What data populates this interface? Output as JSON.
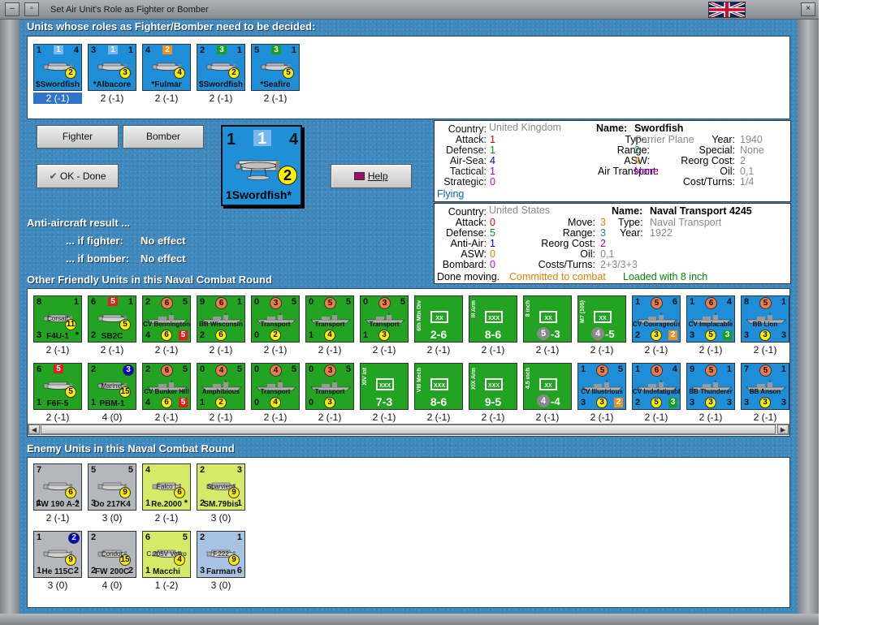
{
  "window": {
    "title": "Set Air Unit's Role as Fighter or Bomber"
  },
  "colors": {
    "panel_blue": "#3f88be",
    "naval": "#1e8ed8",
    "land": "#22a322",
    "enemy_grey": "#b4b8bc",
    "italian": "#d6ea6a",
    "french": "#a7c2e2"
  },
  "sections": {
    "decide": "Units whose roles as Fighter/Bomber need to be decided:",
    "friendly": "Other Friendly Units in this Naval Combat Round",
    "enemy": "Enemy Units in this Naval Combat Round"
  },
  "undecided": [
    {
      "name": "Swordfish",
      "prefix": "$",
      "tl": "1",
      "tr": "4",
      "top": "1",
      "top_color": "#79b7f0",
      "circle": "2",
      "sub": "2 (-1)",
      "selected": true
    },
    {
      "name": "Albacore",
      "prefix": "*",
      "tl": "3",
      "tr": "1",
      "top": "1",
      "top_color": "#79b7f0",
      "circle": "3",
      "sub": "2 (-1)",
      "selected": false
    },
    {
      "name": "Fulmar",
      "prefix": "*",
      "tl": "4",
      "tr": "",
      "top": "2",
      "top_color": "#f09020",
      "circle": "4",
      "sub": "2 (-1)",
      "selected": false
    },
    {
      "name": "Swordfish",
      "prefix": "$",
      "tl": "2",
      "tr": "1",
      "top": "3",
      "top_color": "#1aa01a",
      "circle": "2",
      "sub": "2 (-1)",
      "selected": false
    },
    {
      "name": "Seafire",
      "prefix": "*",
      "tl": "5",
      "tr": "1",
      "top": "3",
      "top_color": "#1aa01a",
      "circle": "5",
      "sub": "2 (-1)",
      "selected": false
    }
  ],
  "buttons": {
    "fighter": "Fighter",
    "bomber": "Bomber",
    "ok": "OK - Done",
    "help": "Help"
  },
  "big_counter": {
    "tl": "1",
    "top": "1",
    "tr": "4",
    "circle": "2",
    "name": "1Swordfish*"
  },
  "anti_aircraft": {
    "header": "Anti-aircraft result ...",
    "fighter_label": "... if fighter:",
    "fighter_value": "No effect",
    "bomber_label": "... if bomber:",
    "bomber_value": "No effect"
  },
  "swordfish_info": {
    "country_label": "Country:",
    "country": "United Kingdom",
    "attack_label": "Attack:",
    "attack": "1",
    "defense_label": "Defense:",
    "defense": "1",
    "airsea_label": "Air-Sea:",
    "airsea": "4",
    "tactical_label": "Tactical:",
    "tactical": "1",
    "strategic_label": "Strategic:",
    "strategic": "0",
    "status": "Flying",
    "name_label": "Name:",
    "name": "Swordfish",
    "type_label": "Type:",
    "type": "Carrier Plane",
    "year_label": "Year:",
    "year": "1940",
    "range_label": "Range:",
    "range": "2",
    "special_label": "Special:",
    "special": "None",
    "asw_label": "ASW:",
    "asw": "4",
    "reorg_label": "Reorg Cost:",
    "reorg": "2",
    "airtransport_label": "Air Transport:",
    "airtransport": "None",
    "oil_label": "Oil:",
    "oil": "0,1",
    "costturns_label": "Cost/Turns:",
    "costturns": "1/4"
  },
  "transport_info": {
    "country_label": "Country:",
    "country": "United States",
    "attack_label": "Attack:",
    "attack": "0",
    "defense_label": "Defense:",
    "defense": "5",
    "antiair_label": "Anti-Air:",
    "antiair": "1",
    "asw_label": "ASW:",
    "asw": "0",
    "bombard_label": "Bombard:",
    "bombard": "0",
    "move_label": "Move:",
    "move": "3",
    "range_label": "Range:",
    "range": "3",
    "reorg_label": "Reorg Cost:",
    "reorg": "2",
    "oil_label": "Oil:",
    "oil": "0,1",
    "costturns_label": "Costs/Turns:",
    "costturns": "2+3/3+3",
    "name_label": "Name:",
    "name": "Naval Transport 4245",
    "type_label": "Type:",
    "type": "Naval Transport",
    "year_label": "Year:",
    "year": "1922",
    "status_done": "Done moving.",
    "status_committed": "Committed to combat",
    "status_loaded": "Loaded with 8 inch"
  },
  "friendly_row1": [
    {
      "kind": "air",
      "bg": "#22a322",
      "label": "F4U-1",
      "sub_label": "Corsair",
      "tl": "8",
      "tr": "1",
      "bl": "3",
      "circle": "11",
      "extra": "*",
      "caption": "2 (-1)"
    },
    {
      "kind": "air",
      "bg": "#22a322",
      "label": "SB2C",
      "tl": "6",
      "top": "5",
      "top_color": "#e02020",
      "tr": "1",
      "bl": "2",
      "circle": "5",
      "caption": "2 (-1)"
    },
    {
      "kind": "ship",
      "bg": "#22a322",
      "label": "CV Bennington",
      "tl": "2",
      "top": "6",
      "tr": "5",
      "bl": "4",
      "circle": "6",
      "br": "5",
      "br_color": "#e02020",
      "caption": "2 (-1)"
    },
    {
      "kind": "ship",
      "bg": "#22a322",
      "label": "BB Wisconsin",
      "tl": "9",
      "top": "6",
      "tr": "1",
      "bl": "2",
      "circle": "6",
      "caption": "2 (-1)"
    },
    {
      "kind": "ship",
      "bg": "#22a322",
      "label": "Transport",
      "tl": "0",
      "top": "3",
      "tr": "5",
      "bl": "0",
      "circle": "2",
      "caption": "2 (-1)"
    },
    {
      "kind": "ship",
      "bg": "#22a322",
      "label": "Transport",
      "tl": "0",
      "top": "5",
      "tr": "5",
      "bl": "1",
      "circle": "4",
      "caption": "2 (-1)"
    },
    {
      "kind": "ship",
      "bg": "#22a322",
      "label": "Transport",
      "tl": "0",
      "top": "3",
      "tr": "5",
      "bl": "1",
      "circle": "3",
      "caption": "2 (-1)"
    },
    {
      "kind": "land",
      "bg": "#22a322",
      "vert": "6th Mtn Div",
      "sym": "XX",
      "val": "2-6",
      "caption": "2 (-1)"
    },
    {
      "kind": "land",
      "bg": "#22a322",
      "vert": "III Arm",
      "sym": "XXX",
      "val": "8-6",
      "caption": "2 (-1)"
    },
    {
      "kind": "land",
      "bg": "#22a322",
      "vert": "8 inch",
      "sym": "XX",
      "val": "5-3",
      "grey": "5",
      "caption": "2 (-1)"
    },
    {
      "kind": "land",
      "bg": "#22a322",
      "vert": "M7 (105)",
      "sym": "XX",
      "val": "4-5",
      "grey": "4",
      "caption": "2 (-1)"
    },
    {
      "kind": "ship",
      "bg": "#1e8ed8",
      "label": "CV Courageous",
      "tl": "1",
      "top": "5",
      "tr": "6",
      "bl": "2",
      "circle": "3",
      "br": "2",
      "br_color": "#f09020",
      "caption": "2 (-1)"
    },
    {
      "kind": "ship",
      "bg": "#1e8ed8",
      "label": "CV Implacable",
      "tl": "1",
      "top": "6",
      "tr": "4",
      "bl": "3",
      "circle": "5",
      "br": "3",
      "br_color": "#1aa01a",
      "caption": "2 (-1)"
    },
    {
      "kind": "ship",
      "bg": "#1e8ed8",
      "label": "BB Lion",
      "tl": "8",
      "top": "5",
      "tr": "1",
      "bl": "3",
      "circle": "3",
      "br": "3",
      "caption": "2 (-1)"
    }
  ],
  "friendly_row2": [
    {
      "kind": "air",
      "bg": "#22a322",
      "label": "F6F-5",
      "tl": "6",
      "top": "5",
      "top_color": "#e02020",
      "tr": "",
      "bl": "1",
      "circle": "5",
      "caption": "2 (-1)"
    },
    {
      "kind": "air",
      "bg": "#22a322",
      "label": "PBM-1",
      "sub_label": "Mariner",
      "tl": "2",
      "top": "",
      "tr": "3",
      "tr_color": "#0000cc",
      "bl": "1",
      "circle": "15",
      "caption": "4 (0)"
    },
    {
      "kind": "ship",
      "bg": "#22a322",
      "label": "CV Bunker Hill",
      "tl": "2",
      "top": "6",
      "tr": "5",
      "bl": "4",
      "circle": "6",
      "br": "5",
      "br_color": "#e02020",
      "caption": "2 (-1)"
    },
    {
      "kind": "ship",
      "bg": "#22a322",
      "label": "Amphibious",
      "tl": "0",
      "top": "4",
      "tr": "5",
      "bl": "1",
      "circle": "2",
      "caption": "2 (-1)"
    },
    {
      "kind": "ship",
      "bg": "#22a322",
      "label": "Transport",
      "tl": "0",
      "top": "4",
      "tr": "5",
      "bl": "0",
      "circle": "4",
      "caption": "2 (-1)"
    },
    {
      "kind": "ship",
      "bg": "#22a322",
      "label": "Transport",
      "tl": "0",
      "top": "3",
      "tr": "5",
      "bl": "0",
      "circle": "3",
      "caption": "2 (-1)"
    },
    {
      "kind": "land",
      "bg": "#22a322",
      "vert": "XIV Inf",
      "sym": "XXX",
      "val": "7-3",
      "caption": "2 (-1)"
    },
    {
      "kind": "land",
      "bg": "#22a322",
      "vert": "VIII Mech",
      "sym": "XXX",
      "val": "8-6",
      "caption": "2 (-1)"
    },
    {
      "kind": "land",
      "bg": "#22a322",
      "vert": "XIX Arm",
      "sym": "XXX",
      "val": "9-5",
      "caption": "2 (-1)"
    },
    {
      "kind": "land",
      "bg": "#22a322",
      "vert": "4.5 inch",
      "sym": "XX",
      "val": "4-4",
      "grey": "4",
      "caption": "2 (-1)"
    },
    {
      "kind": "ship",
      "bg": "#1e8ed8",
      "label": "CV Illustrious",
      "tl": "1",
      "top": "5",
      "tr": "5",
      "bl": "3",
      "circle": "3",
      "br": "2",
      "br_color": "#f09020",
      "caption": "2 (-1)"
    },
    {
      "kind": "ship",
      "bg": "#1e8ed8",
      "label": "CV Indefatigable",
      "tl": "1",
      "top": "6",
      "tr": "4",
      "bl": "2",
      "circle": "5",
      "br": "3",
      "br_color": "#1aa01a",
      "caption": "2 (-1)"
    },
    {
      "kind": "ship",
      "bg": "#1e8ed8",
      "label": "BB Thunderer",
      "tl": "9",
      "top": "5",
      "tr": "1",
      "bl": "3",
      "circle": "3",
      "br": "3",
      "caption": "2 (-1)"
    },
    {
      "kind": "ship",
      "bg": "#1e8ed8",
      "label": "BB Anson",
      "tl": "7",
      "top": "5",
      "tr": "1",
      "bl": "3",
      "circle": "3",
      "br": "3",
      "caption": "2 (-1)"
    }
  ],
  "enemy_row1": [
    {
      "bg": "#b4b8bc",
      "label": "FW 190 A-2",
      "tl": "7",
      "tr": "",
      "bl": "1",
      "circle": "6",
      "br": "*",
      "caption": "2 (-1)"
    },
    {
      "bg": "#b4b8bc",
      "label": "Do 217K4",
      "tl": "5",
      "tr": "5",
      "bl": "3",
      "circle": "9",
      "caption": "3 (0)"
    },
    {
      "bg": "#d6ea6a",
      "label": "Re.2000",
      "sub_label": "Falco I",
      "tl": "4",
      "tr": "",
      "bl": "1",
      "circle": "6",
      "br": "*",
      "caption": "2 (-1)"
    },
    {
      "bg": "#d6ea6a",
      "label": "SM.79bis",
      "sub_label": "Sparviero",
      "tl": "2",
      "tr": "3",
      "bl": "2",
      "circle": "9",
      "br": "1",
      "caption": "3 (0)"
    }
  ],
  "enemy_row2": [
    {
      "bg": "#b4b8bc",
      "label": "He 115C",
      "tl": "1",
      "tr": "2",
      "tr_color": "#0000cc",
      "bl": "1",
      "circle": "9",
      "br": "2",
      "caption": "3 (0)"
    },
    {
      "bg": "#b4b8bc",
      "label": "FW 200C",
      "sub_label": "Condor",
      "tl": "2",
      "tr": "",
      "bl": "2",
      "circle": "15",
      "br": "2",
      "caption": "4 (0)"
    },
    {
      "bg": "#d6ea6a",
      "label": "Macchi",
      "sub_label": "C.205V Veltro",
      "tl": "6",
      "tr": "5",
      "bl": "1",
      "circle": "4",
      "br": "",
      "caption": "1 (-2)"
    },
    {
      "bg": "#a7c2e2",
      "label": "Farman",
      "sub_label": "F.222",
      "tl": "2",
      "tr": "1",
      "bl": "3",
      "circle": "9",
      "br": "6",
      "caption": "3 (0)"
    }
  ]
}
